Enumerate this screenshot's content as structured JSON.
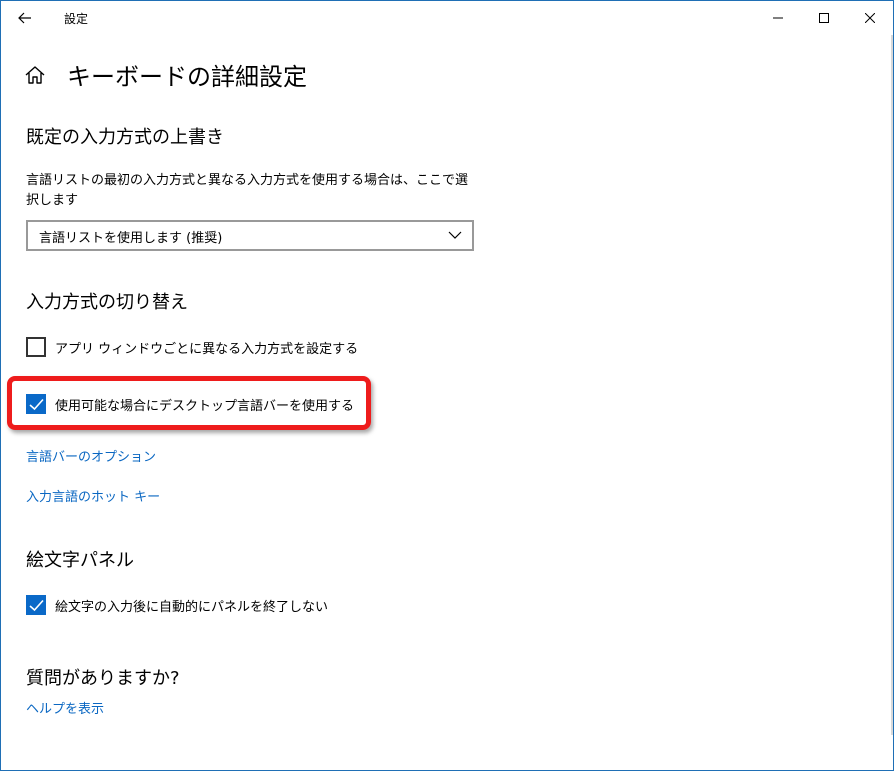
{
  "window": {
    "app_title": "設定",
    "accent_color": "#0a69c8",
    "link_color": "#0a67c2",
    "highlight_color": "#ee1c1c"
  },
  "titlebar": {
    "back_icon": "arrow-left-icon",
    "minimize_icon": "minimize-icon",
    "maximize_icon": "maximize-icon",
    "close_icon": "close-icon"
  },
  "header": {
    "home_icon": "home-icon",
    "title": "キーボードの詳細設定"
  },
  "override_section": {
    "heading": "既定の入力方式の上書き",
    "description": "言語リストの最初の入力方式と異なる入力方式を使用する場合は、ここで選択します",
    "dropdown_value": "言語リストを使用します (推奨)"
  },
  "switch_section": {
    "heading": "入力方式の切り替え",
    "checkbox_per_app": {
      "label": "アプリ ウィンドウごとに異なる入力方式を設定する",
      "checked": false
    },
    "checkbox_desktop_bar": {
      "label": "使用可能な場合にデスクトップ言語バーを使用する",
      "checked": true
    },
    "link_language_bar_options": "言語バーのオプション",
    "link_input_hotkeys": "入力言語のホット キー"
  },
  "emoji_section": {
    "heading": "絵文字パネル",
    "checkbox_keep_open": {
      "label": "絵文字の入力後に自動的にパネルを終了しない",
      "checked": true
    }
  },
  "help_section": {
    "heading": "質問がありますか?",
    "link_help": "ヘルプを表示"
  }
}
